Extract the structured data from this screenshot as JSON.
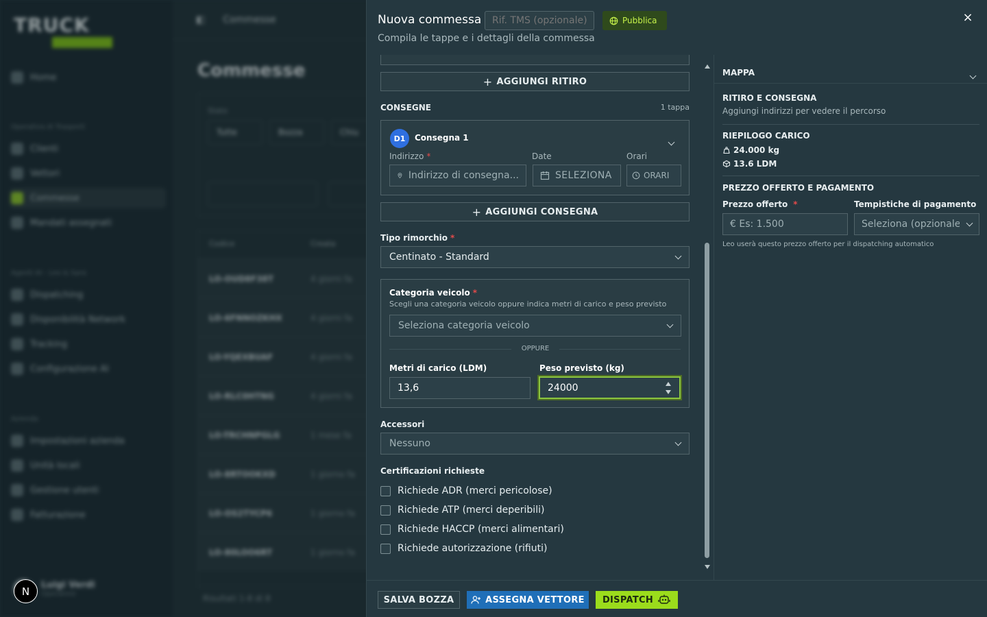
{
  "background": {
    "logo": "TRUCK",
    "nav_sections": [
      "Operativa di Trasporti",
      "Agenti AI - Leo & Sara",
      "Azienda"
    ],
    "nav_items": [
      "Home",
      "Clienti",
      "Vettori",
      "Commesse",
      "Mandati assegnati",
      "Dispatching",
      "Disponibilità Network",
      "Tracking",
      "Configurazione AI",
      "Impostazioni azienda",
      "Unità locali",
      "Gestione utenti",
      "Fatturazione"
    ],
    "topbar_breadcrumb": "Commesse",
    "page_title": "Commesse",
    "filter_label": "Stato",
    "filter_chips": [
      "Tutte",
      "Bozza",
      "Chiu"
    ],
    "table_headers": [
      "Codice",
      "Creata"
    ],
    "rows": [
      {
        "code": "LO-OUD8F38T",
        "created": "4 giorni fa"
      },
      {
        "code": "LO-6FNNOZKHX",
        "created": "4 giorni fa"
      },
      {
        "code": "LO-YQEXBUAF",
        "created": "4 giorni fa"
      },
      {
        "code": "LO-RLC0HTNG",
        "created": "4 giorni fa"
      },
      {
        "code": "LO-TRCHNPGLG",
        "created": "1 mese fa"
      },
      {
        "code": "LO-8RTOOKXD",
        "created": "1 giorno fa"
      },
      {
        "code": "LO-OS2TYCP6",
        "created": "1 giorno fa"
      },
      {
        "code": "LO-80LOO6RT",
        "created": "1 giorno fa"
      }
    ],
    "footer_text": "Risultati 1-8 di 8",
    "user_name": "Luigi Verdi",
    "user_avatar": "N"
  },
  "drawer": {
    "title": "Nuova commessa",
    "rif_tms_placeholder": "Rif. TMS (opzionale)",
    "pubblica_label": "Pubblica",
    "subtitle": "Compila le tappe e i dettagli della commessa",
    "close_icon": "×"
  },
  "form": {
    "add_pickup": "AGGIUNGI RITIRO",
    "deliveries_label": "CONSEGNE",
    "deliveries_count": "1 tappa",
    "delivery": {
      "badge": "D1",
      "title": "Consegna 1",
      "address_label": "Indirizzo",
      "date_label": "Date",
      "hours_label": "Orari",
      "address_placeholder": "Indirizzo di consegna...",
      "date_button": "SELEZIONA",
      "hours_button": "ORARI"
    },
    "add_delivery": "AGGIUNGI CONSEGNA",
    "trailer_label": "Tipo rimorchio",
    "trailer_value": "Centinato - Standard",
    "vehicle_category_label": "Categoria veicolo",
    "vehicle_category_hint": "Scegli una categoria veicolo oppure indica metri di carico e peso previsto",
    "vehicle_category_placeholder": "Seleziona categoria veicolo",
    "oppure": "OPPURE",
    "ldm_label": "Metri di carico (LDM)",
    "ldm_value": "13,6",
    "weight_label": "Peso previsto (kg)",
    "weight_value": "24000",
    "accessories_label": "Accessori",
    "accessories_value": "Nessuno",
    "certifications_label": "Certificazioni richieste",
    "certifications": [
      "Richiede ADR (merci pericolose)",
      "Richiede ATP (merci deperibili)",
      "Richiede HACCP (merci alimentari)",
      "Richiede autorizzazione (rifiuti)"
    ]
  },
  "summary": {
    "map_label": "MAPPA",
    "route_title": "RITIRO E CONSEGNA",
    "route_hint": "Aggiungi indirizzi per vedere il percorso",
    "load_title": "RIEPILOGO CARICO",
    "load_weight": "24.000 kg",
    "load_ldm": "13.6 LDM",
    "price_title": "PREZZO OFFERTO E PAGAMENTO",
    "price_label": "Prezzo offerto",
    "price_placeholder": "€  Es: 1.500",
    "payment_label": "Tempistiche di pagamento",
    "payment_placeholder": "Seleziona (opzionale",
    "price_note": "Leo userà questo prezzo offerto per il dispatching automatico"
  },
  "footer": {
    "save_draft": "SALVA BOZZA",
    "assign_carrier": "ASSEGNA VETTORE",
    "dispatch": "DISPATCH"
  },
  "colors": {
    "accent_green": "#9bdc1c",
    "assign_blue": "#1f6fb8",
    "badge_blue": "#2f6fe0",
    "required_red": "#e24a4a"
  }
}
